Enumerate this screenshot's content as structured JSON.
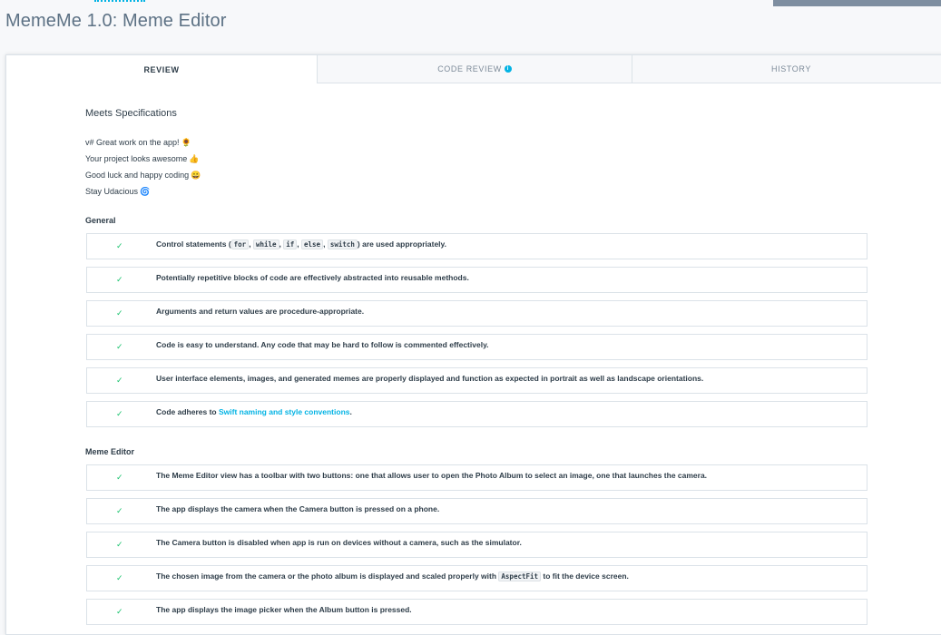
{
  "header": {
    "title": "MemeMe 1.0: Meme Editor"
  },
  "tabs": [
    {
      "label": "REVIEW",
      "active": true
    },
    {
      "label": "CODE REVIEW",
      "active": false,
      "icon": "info-icon"
    },
    {
      "label": "HISTORY",
      "active": false
    }
  ],
  "review": {
    "status": "Meets Specifications",
    "notes": [
      {
        "text": "v# Great work on the app!",
        "emoji": "🌻"
      },
      {
        "text": "Your project looks awesome",
        "emoji": "👍"
      },
      {
        "text": "Good luck and happy coding",
        "emoji": "😀"
      },
      {
        "text": "Stay Udacious",
        "emoji": "🌀"
      }
    ]
  },
  "sections": [
    {
      "title": "General",
      "items": [
        {
          "parts": [
            "Control statements (",
            "for",
            ", ",
            "while",
            ", ",
            "if",
            ", ",
            "else",
            ", ",
            "switch",
            ") are used appropriately."
          ]
        },
        {
          "text": "Potentially repetitive blocks of code are effectively abstracted into reusable methods."
        },
        {
          "text": "Arguments and return values are procedure-appropriate."
        },
        {
          "text": "Code is easy to understand. Any code that may be hard to follow is commented effectively."
        },
        {
          "text": "User interface elements, images, and generated memes are properly displayed and function as expected in portrait as well as landscape orientations."
        },
        {
          "prefix": "Code adheres to ",
          "link": "Swift naming and style conventions",
          "suffix": "."
        }
      ]
    },
    {
      "title": "Meme Editor",
      "items": [
        {
          "text": "The Meme Editor view has a toolbar with two buttons: one that allows user to open the Photo Album to select an image, one that launches the camera."
        },
        {
          "text": "The app displays the camera when the Camera button is pressed on a phone."
        },
        {
          "text": "The Camera button is disabled when app is run on devices without a camera, such as the simulator."
        },
        {
          "prefix": "The chosen image from the camera or the photo album is displayed and scaled properly with ",
          "code": "AspectFit",
          "suffix": " to fit the device screen."
        },
        {
          "text": "The app displays the image picker when the Album button is pressed."
        }
      ]
    }
  ],
  "check_glyph": "✓",
  "colors": {
    "accent": "#02b3e4",
    "check": "#15c26b",
    "text": "#2e3d49"
  }
}
